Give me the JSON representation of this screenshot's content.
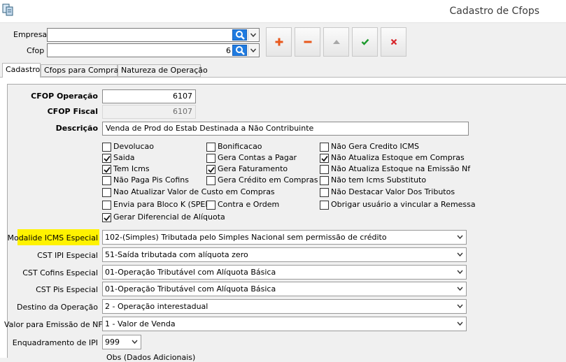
{
  "window": {
    "title": "Cadastro de Cfops"
  },
  "top": {
    "empresa_label": "Empresa",
    "empresa_value": "",
    "cfop_label": "Cfop",
    "cfop_value": "6"
  },
  "toolbar": {
    "add_icon": "plus-icon",
    "remove_icon": "minus-icon",
    "up_icon": "triangle-up-icon",
    "confirm_icon": "check-icon",
    "cancel_icon": "x-icon"
  },
  "tabs": [
    {
      "label": "Cadastro",
      "active": true
    },
    {
      "label": "Cfops para Compras",
      "active": false
    },
    {
      "label": "Natureza de Operação",
      "active": false
    }
  ],
  "form": {
    "cfop_operacao_label": "CFOP Operação",
    "cfop_operacao_value": "6107",
    "cfop_fiscal_label": "CFOP Fiscal",
    "cfop_fiscal_value": "6107",
    "descricao_label": "Descrição",
    "descricao_value": "Venda de Prod do Estab Destinada a Não Contribuinte"
  },
  "checkboxes": {
    "devolucao": {
      "label": "Devolucao",
      "checked": false
    },
    "saida": {
      "label": "Saida",
      "checked": true
    },
    "tem_icms": {
      "label": "Tem Icms",
      "checked": true
    },
    "nao_paga_pis": {
      "label": "Não Paga Pis Cofins",
      "checked": false
    },
    "nao_atualizar_custo": {
      "label": "Nao Atualizar Valor de Custo em Compras",
      "checked": false
    },
    "bloco_k": {
      "label": "Envia para Bloco K (SPED)",
      "checked": false
    },
    "gerar_dif": {
      "label": "Gerar Diferencial de Alíquota",
      "checked": true
    },
    "bonificacao": {
      "label": "Bonificacao",
      "checked": false
    },
    "gera_contas": {
      "label": "Gera Contas a Pagar",
      "checked": false
    },
    "gera_faturamento": {
      "label": "Gera Faturamento",
      "checked": true
    },
    "gera_credito": {
      "label": "Gera Crédito em Compras",
      "checked": false
    },
    "contra_ordem": {
      "label": "Contra e Ordem",
      "checked": false
    },
    "nao_gera_credito_icms": {
      "label": "Não Gera Credito ICMS",
      "checked": false
    },
    "nao_atualiza_estoque_compras": {
      "label": "Não Atualiza Estoque em Compras",
      "checked": true
    },
    "nao_atualiza_estoque_nf": {
      "label": "Não Atualiza Estoque na Emissão Nf",
      "checked": false
    },
    "nao_tem_icms_st": {
      "label": "Não tem Icms Substituto",
      "checked": false
    },
    "nao_destacar_tributos": {
      "label": "Não Destacar Valor Dos Tributos",
      "checked": false
    },
    "obrigar_remessa": {
      "label": "Obrigar usuário a vincular a Remessa",
      "checked": false
    }
  },
  "selects": {
    "modalidade_icms": {
      "label": "Modalide ICMS Especial",
      "value": "102-(Simples) Tributada pelo Simples Nacional sem permissão de crédito"
    },
    "cst_ipi": {
      "label": "CST IPI Especial",
      "value": "51-Saída tributada com alíquota zero"
    },
    "cst_cofins": {
      "label": "CST Cofins Especial",
      "value": "01-Operação Tributável com Alíquota Básica"
    },
    "cst_pis": {
      "label": "CST Pis Especial",
      "value": "01-Operação Tributável com Alíquota Básica"
    },
    "destino": {
      "label": "Destino da Operação",
      "value": "2 - Operação interestadual"
    },
    "valor_nf": {
      "label": "Valor para Emissão de NF",
      "value": "1 - Valor de Venda"
    },
    "enquadramento": {
      "label": "Enquadramento de IPI",
      "value": "999"
    }
  },
  "obs_label": "Obs (Dados Adicionais)",
  "colors": {
    "highlight": "#fff200",
    "search_button": "#1f7be0",
    "add": "#e8581c",
    "remove": "#e8581c",
    "confirm": "#1e9a2e",
    "cancel": "#d7262b"
  }
}
